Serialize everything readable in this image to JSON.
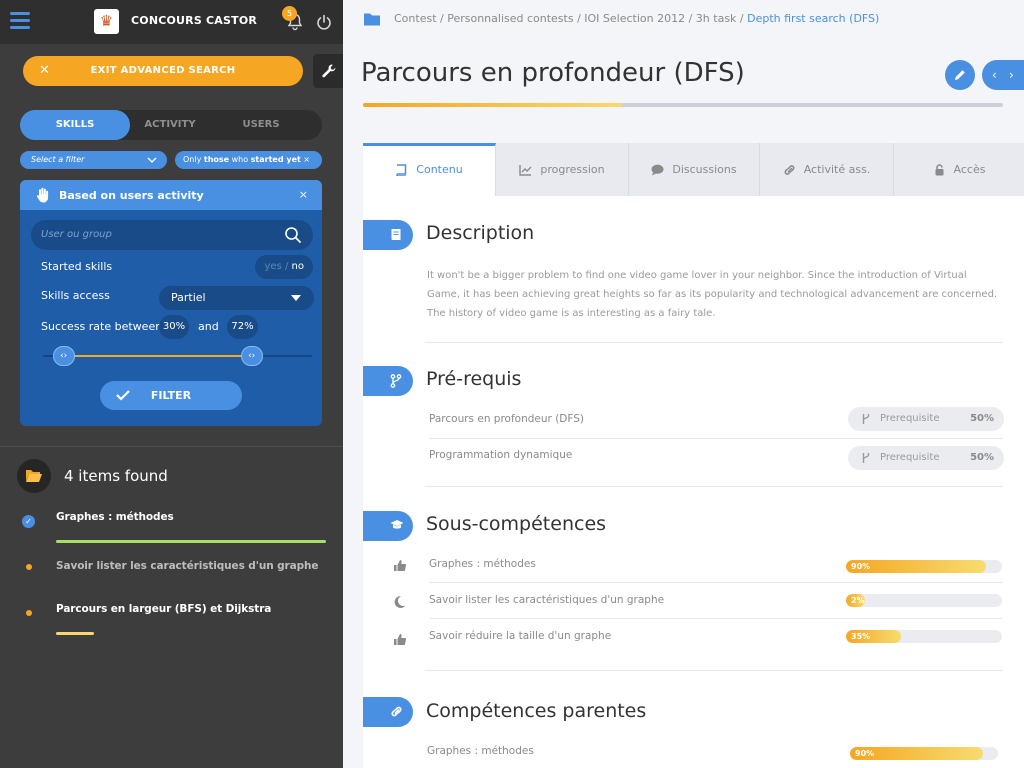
{
  "app": {
    "title": "CONCOURS CASTOR",
    "notification_count": "5"
  },
  "sidebar": {
    "exit_label": "EXIT ADVANCED SEARCH",
    "tabs": [
      {
        "label": "SKILLS",
        "active": true
      },
      {
        "label": "ACTIVITY",
        "active": false
      },
      {
        "label": "USERS",
        "active": false
      }
    ],
    "filter_select_placeholder": "Select a filter",
    "filter_chip": {
      "prefix": "Only ",
      "bold1": "those",
      "middle": " who ",
      "bold2": "started yet",
      "close": "×"
    },
    "activity_panel": {
      "title": "Based on users activity",
      "close": "×",
      "search_placeholder": "User ou group",
      "started_label": "Started skills",
      "started_yes": "yes",
      "started_sep": " / ",
      "started_no": "no",
      "access_label": "Skills access",
      "access_value": "Partiel",
      "success_label": "Success rate between",
      "success_min": "30%",
      "success_and": "and",
      "success_max": "72%",
      "range_min_fraction": 0.3,
      "range_max_fraction": 0.72,
      "filter_label": "FILTER"
    },
    "results_count_label": "4 items found",
    "results": [
      {
        "label": "Graphes : méthodes",
        "checked": true,
        "progress": 1.0,
        "color": "#a8e063"
      },
      {
        "label": "Savoir lister les caractéristiques d'un graphe",
        "checked": false,
        "progress": 0
      },
      {
        "label": "Parcours en largeur (BFS) et Dijkstra",
        "checked": false,
        "progress": 0.14,
        "color": "#f8d86b"
      }
    ]
  },
  "main": {
    "breadcrumb": {
      "path": "Contest / Personnalised contests / IOI Selection 2012 / 3h task / ",
      "current": "Depth first search (DFS)"
    },
    "title": "Parcours en profondeur (DFS)",
    "title_progress_fraction": 0.405,
    "tabs": [
      {
        "label": "Contenu",
        "icon": "book-icon",
        "active": true
      },
      {
        "label": "progression",
        "icon": "chart-icon",
        "active": false
      },
      {
        "label": "Discussions",
        "icon": "comment-icon",
        "active": false
      },
      {
        "label": "Activité ass.",
        "icon": "link-icon",
        "active": false
      },
      {
        "label": "Accès",
        "icon": "lock-icon",
        "active": false
      }
    ],
    "description": {
      "title": "Description",
      "text": "It won't be a bigger problem to find one video game lover in your neighbor. Since the introduction of Virtual Game, it has been achieving great heights so far as its popularity and technological advancement are concerned. The history of video game is as interesting as a fairy tale."
    },
    "prerequisites": {
      "title": "Pré-requis",
      "items": [
        {
          "label": "Parcours en profondeur (DFS)",
          "tag": "Prerequisite",
          "pct": "50%"
        },
        {
          "label": "Programmation dynamique",
          "tag": "Prerequisite",
          "pct": "50%"
        }
      ]
    },
    "subskills": {
      "title": "Sous-compétences",
      "items": [
        {
          "label": "Graphes : méthodes",
          "icon": "thumbs-up-icon",
          "pct": "90%",
          "value": 0.9
        },
        {
          "label": "Savoir lister les caractéristiques d'un graphe",
          "icon": "moon-icon",
          "pct": "2%",
          "value": 0.02
        },
        {
          "label": "Savoir réduire la taille d'un graphe",
          "icon": "thumbs-up-icon",
          "pct": "35%",
          "value": 0.35
        }
      ]
    },
    "parents": {
      "title": "Compétences parentes",
      "items": [
        {
          "label": "Graphes : méthodes",
          "pct": "90%",
          "value": 0.9
        }
      ]
    }
  },
  "colors": {
    "accent": "#4a90e2",
    "warning": "#f5a623",
    "sidebar_bg": "#3d3d3d",
    "panel_bg": "#1f5da8"
  }
}
